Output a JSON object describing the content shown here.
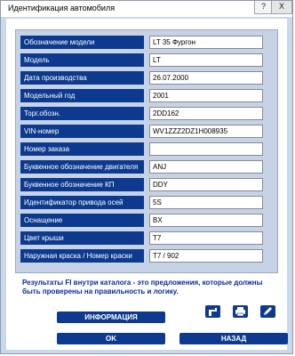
{
  "window": {
    "title": "Идентификация автомобиля",
    "help_label": "?",
    "close_label": "X"
  },
  "rows": [
    {
      "label": "Обозначение модели",
      "value": "LT 35 Фургон"
    },
    {
      "label": "Модель",
      "value": "LT"
    },
    {
      "label": "Дата производства",
      "value": "26.07.2000"
    },
    {
      "label": "Модельный год",
      "value": "2001"
    },
    {
      "label": "Торг.обозн.",
      "value": "2DD162"
    },
    {
      "label": "VIN-номер",
      "value": "WV1ZZZ2DZ1H008935"
    },
    {
      "label": "Номер заказа",
      "value": ""
    },
    {
      "label": "Буквенное обозначение двигателя",
      "value": "ANJ"
    },
    {
      "label": "Буквенное обозначение КП",
      "value": "DDY"
    },
    {
      "label": "Идентификатор привода осей",
      "value": "5S"
    },
    {
      "label": "Оснащение",
      "value": "BX"
    },
    {
      "label": "Цвет крыши",
      "value": "T7"
    },
    {
      "label": "Наружная краска / Номер краски",
      "value": "T7 / 902"
    }
  ],
  "note": "Результаты  FI внутри каталога - это предложения, которые должны быть проверены на правильность и логику.",
  "icons": [
    "export-icon",
    "print-icon",
    "edit-icon"
  ],
  "buttons": {
    "info": "ИНФОРМАЦИЯ",
    "ok": "OK",
    "back": "НАЗАД"
  },
  "colors": {
    "accent": "#0d3a8e",
    "panel": "#c6d3e6",
    "frame": "#c9d9ec"
  }
}
